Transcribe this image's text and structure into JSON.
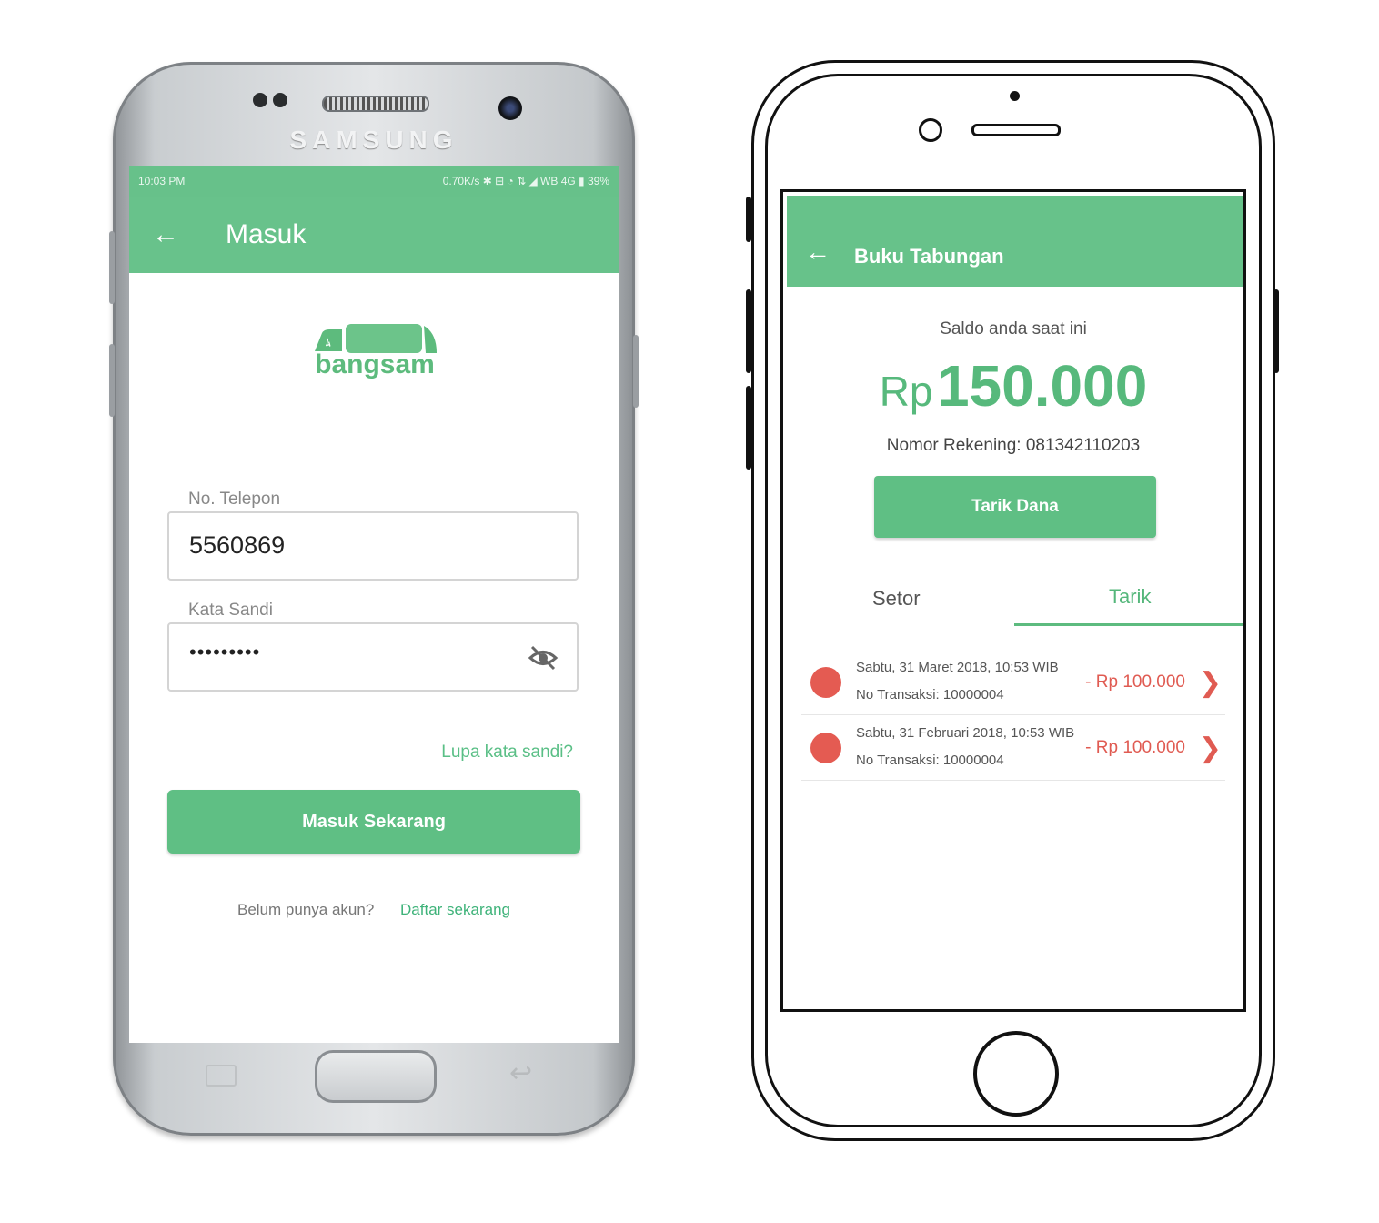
{
  "left_phone": {
    "brand": "SAMSUNG",
    "status_time": "10:03 PM",
    "status_right": "0.70K/s ✱ ⊟ ◔ ⇅ ◢ WB 4G ▮ 39%",
    "appbar_title": "Masuk",
    "logo_text": "bangsam",
    "phone_label": "No. Telepon",
    "phone_value": "5560869",
    "password_label": "Kata Sandi",
    "password_value": "•••••••••",
    "forgot_link": "Lupa kata sandi?",
    "login_button": "Masuk Sekarang",
    "no_account_text": "Belum punya akun?",
    "register_link": "Daftar sekarang"
  },
  "right_phone": {
    "appbar_title": "Buku Tabungan",
    "saldo_label": "Saldo anda saat ini",
    "saldo_currency": "Rp",
    "saldo_amount": "150.000",
    "rekening": "Nomor Rekening: 081342110203",
    "withdraw_button": "Tarik Dana",
    "tabs": [
      {
        "label": "Setor",
        "active": false
      },
      {
        "label": "Tarik",
        "active": true
      }
    ],
    "transactions": [
      {
        "date": "Sabtu, 31 Maret 2018, 10:53 WIB",
        "tx": "No Transaksi: 10000004",
        "amount": "- Rp 100.000"
      },
      {
        "date": "Sabtu, 31 Februari 2018, 10:53 WIB",
        "tx": "No Transaksi: 10000004",
        "amount": "- Rp 100.000"
      }
    ]
  },
  "colors": {
    "primary_green": "#67c28a",
    "negative_red": "#e05b52"
  },
  "icons": [
    "back-arrow-icon",
    "eye-off-icon",
    "chevron-right-icon",
    "truck-logo-icon"
  ]
}
